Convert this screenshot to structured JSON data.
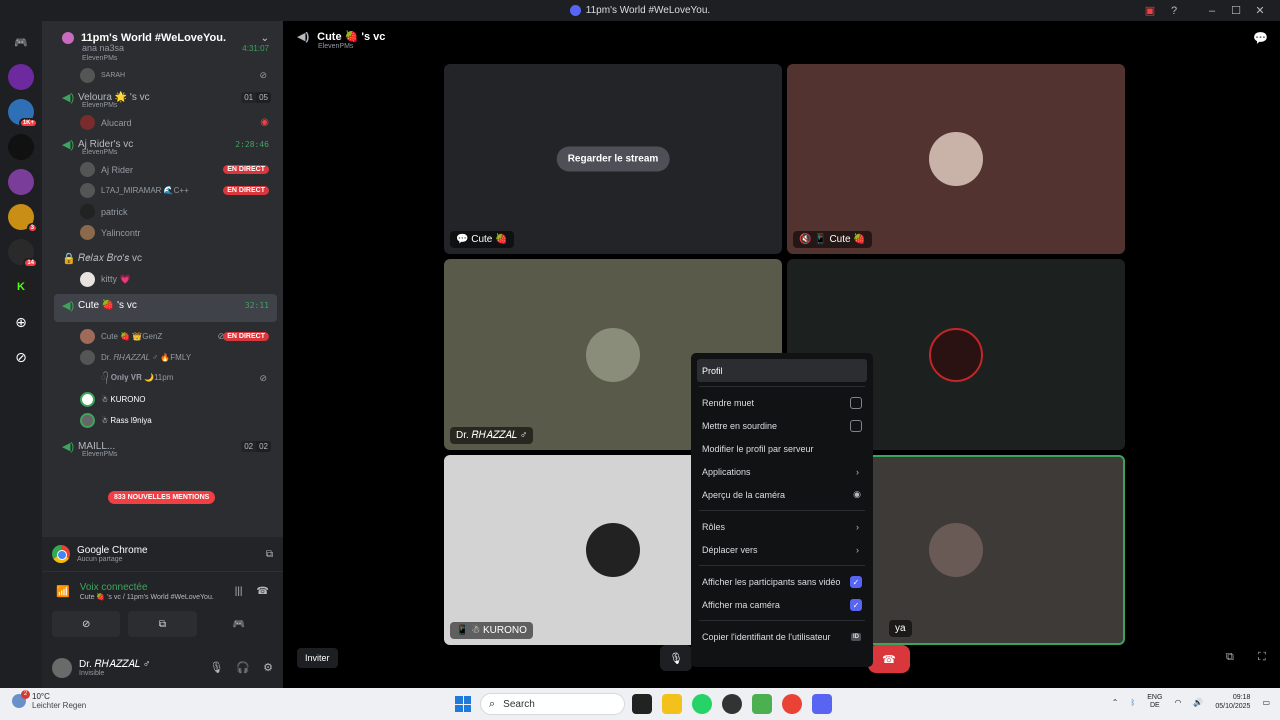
{
  "window": {
    "title": "11pm's World #WeLoveYou."
  },
  "guild_badges": [
    "1K+",
    "3",
    "14"
  ],
  "server": {
    "name": "11pm's World #WeLoveYou."
  },
  "channels": [
    {
      "user_partial": "ana na3sa",
      "time": "4:31:07",
      "sub": "ElevenPMs",
      "users": [
        {
          "name": "SARAH",
          "mic_muted": true
        }
      ]
    },
    {
      "name": "Veloura 🌟 's vc",
      "counts": [
        "01",
        "05"
      ],
      "sub": "ElevenPMs",
      "users": [
        {
          "name": "Alucard",
          "icon": "◉"
        }
      ]
    },
    {
      "name": "Aj Rider's vc",
      "time": "2:28:46",
      "sub": "ElevenPMs",
      "users": [
        {
          "name": "Aj Rider",
          "live": "EN DIRECT"
        },
        {
          "name": "L7AJ_MIRAMAR 🌊C++",
          "live": "EN DIRECT"
        },
        {
          "name": "patrick"
        },
        {
          "name": "Yalincontr"
        }
      ]
    },
    {
      "name": "𝑅𝑒𝑙𝑎𝑥 𝐵𝑟𝑜'𝑠 vc",
      "locked": true,
      "users": [
        {
          "name": "kitty 💗"
        }
      ]
    },
    {
      "name": "Cute 🍓 's vc",
      "time": "32:11",
      "sub": "ElevenPMs",
      "active": true,
      "users": [
        {
          "name": "Cute 🍓 👑GenZ",
          "live": "EN DIRECT",
          "mic_muted": true
        },
        {
          "name": "Dr. 𝑅𝐻𝐴𝑍𝑍𝐴𝐿 ♂ 🔥FMLY"
        },
        {
          "name": "᭄ 𝐎𝐧𝐥𝐲 𝐕𝐑 🌙11pm",
          "mic_muted": true
        },
        {
          "name": "☃ KURONO",
          "bright": true
        },
        {
          "name": "☃ Rass l9niya",
          "bright": true
        }
      ]
    },
    {
      "name": "MAILL...",
      "counts": [
        "02",
        "02"
      ],
      "sub": "ElevenPMs"
    }
  ],
  "mentions_pill": "833 NOUVELLES MENTIONS",
  "stream_panel": {
    "app": "Google Chrome",
    "sharing": "Aucun partage"
  },
  "voice_panel": {
    "status": "Voix connectée",
    "location": "Cute 🍓 's vc / 11pm's World #WeLoveYou."
  },
  "current_user": {
    "name": "Dr. 𝑅𝐻𝐴𝑍𝑍𝐴𝐿 ♂",
    "status": "Invisible"
  },
  "vc_header": {
    "name": "Cute 🍓 's vc",
    "sub": "ElevenPMs"
  },
  "tiles": [
    {
      "label": "💬 Cute 🍓",
      "watch": "Regarder le stream"
    },
    {
      "label": "🔇 📱 Cute 🍓"
    },
    {
      "label": "Dr. 𝑅𝐻𝐴𝑍𝑍𝐴𝐿 ♂"
    },
    {
      "label": ""
    },
    {
      "label": "📱 ☃ KURONO"
    },
    {
      "label": "ya"
    }
  ],
  "invite_label": "Inviter",
  "context_menu": {
    "profile": "Profil",
    "mute": "Rendre muet",
    "deafen": "Mettre en sourdine",
    "edit_server_profile": "Modifier le profil par serveur",
    "apps": "Applications",
    "camera_preview": "Aperçu de la caméra",
    "roles": "Rôles",
    "move_to": "Déplacer vers",
    "show_no_video": "Afficher les participants sans vidéo",
    "show_my_camera": "Afficher ma caméra",
    "copy_id": "Copier l'identifiant de l'utilisateur",
    "id_badge": "ID"
  },
  "taskbar": {
    "temp": "10°C",
    "weather": "Leichter Regen",
    "weather_badge": "2",
    "search": "Search",
    "lang1": "ENG",
    "lang2": "DE",
    "time": "09:18",
    "date": "05/10/2025"
  }
}
